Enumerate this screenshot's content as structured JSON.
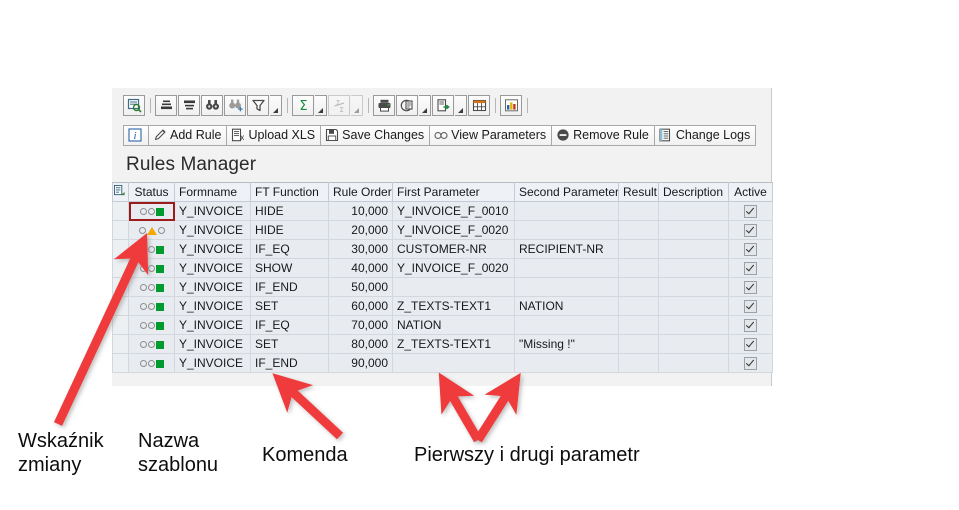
{
  "app": {
    "grid_title": "Rules Manager"
  },
  "icon_toolbar": {
    "buttons": [
      {
        "name": "details-icon",
        "glyph": "detail"
      },
      {
        "name": "sort-ascending-icon",
        "glyph": "sort-asc"
      },
      {
        "name": "sort-descending-icon",
        "glyph": "sort-desc"
      },
      {
        "name": "find-icon",
        "glyph": "binoculars"
      },
      {
        "name": "find-next-icon",
        "glyph": "binoculars-plus"
      },
      {
        "name": "filter-icon",
        "glyph": "funnel",
        "dropdown": true
      },
      {
        "name": "total-icon",
        "glyph": "sigma",
        "dropdown": true
      },
      {
        "name": "subtotal-icon",
        "glyph": "sigma-fraction",
        "dropdown": true,
        "disabled": true
      },
      {
        "name": "print-icon",
        "glyph": "printer"
      },
      {
        "name": "export-view-icon",
        "glyph": "view-export",
        "dropdown": true
      },
      {
        "name": "export-icon",
        "glyph": "export-arrow",
        "dropdown": true
      },
      {
        "name": "layout-icon",
        "glyph": "table-grid"
      },
      {
        "name": "graphic-icon",
        "glyph": "bar-chart"
      }
    ]
  },
  "fn_toolbar": {
    "buttons": [
      {
        "label": "",
        "icon": "info-icon",
        "name": "info-button"
      },
      {
        "label": "Add Rule",
        "icon": "pencil-icon",
        "name": "add-rule-button"
      },
      {
        "label": "Upload XLS",
        "icon": "xls-upload-icon",
        "name": "upload-xls-button"
      },
      {
        "label": "Save Changes",
        "icon": "floppy-icon",
        "name": "save-changes-button"
      },
      {
        "label": "View Parameters",
        "icon": "glasses-icon",
        "name": "view-parameters-button"
      },
      {
        "label": "Remove Rule",
        "icon": "minus-circle-icon",
        "name": "remove-rule-button"
      },
      {
        "label": "Change Logs",
        "icon": "log-book-icon",
        "name": "change-logs-button"
      }
    ]
  },
  "grid": {
    "columns": [
      {
        "key": "status",
        "label": "Status",
        "width": 46,
        "align": "center"
      },
      {
        "key": "form",
        "label": "Formname",
        "width": 76,
        "align": "left"
      },
      {
        "key": "ft",
        "label": "FT Function",
        "width": 78,
        "align": "left"
      },
      {
        "key": "order",
        "label": "Rule Order",
        "width": 64,
        "align": "right"
      },
      {
        "key": "param1",
        "label": "First Parameter",
        "width": 122,
        "align": "left"
      },
      {
        "key": "param2",
        "label": "Second Parameter",
        "width": 104,
        "align": "left"
      },
      {
        "key": "result",
        "label": "Result",
        "width": 40,
        "align": "left"
      },
      {
        "key": "descr",
        "label": "Description",
        "width": 70,
        "align": "left"
      },
      {
        "key": "active",
        "label": "Active",
        "width": 44,
        "align": "center"
      }
    ],
    "rows": [
      {
        "status": "ring-ring-greensquare",
        "selected": true,
        "form": "Y_INVOICE",
        "ft": "HIDE",
        "order": "10,000",
        "param1": "Y_INVOICE_F_0010",
        "param2": "",
        "result": "",
        "descr": "",
        "active": true
      },
      {
        "status": "ring-orangetriangle-ring",
        "selected": false,
        "form": "Y_INVOICE",
        "ft": "HIDE",
        "order": "20,000",
        "param1": "Y_INVOICE_F_0020",
        "param2": "",
        "result": "",
        "descr": "",
        "active": true
      },
      {
        "status": "ring-ring-greensquare",
        "selected": false,
        "form": "Y_INVOICE",
        "ft": "IF_EQ",
        "order": "30,000",
        "param1": "CUSTOMER-NR",
        "param2": "RECIPIENT-NR",
        "result": "",
        "descr": "",
        "active": true
      },
      {
        "status": "ring-ring-greensquare",
        "selected": false,
        "form": "Y_INVOICE",
        "ft": "SHOW",
        "order": "40,000",
        "param1": "Y_INVOICE_F_0020",
        "param2": "",
        "result": "",
        "descr": "",
        "active": true
      },
      {
        "status": "ring-ring-greensquare",
        "selected": false,
        "form": "Y_INVOICE",
        "ft": "IF_END",
        "order": "50,000",
        "param1": "",
        "param2": "",
        "result": "",
        "descr": "",
        "active": true
      },
      {
        "status": "ring-ring-greensquare",
        "selected": false,
        "form": "Y_INVOICE",
        "ft": "SET",
        "order": "60,000",
        "param1": "Z_TEXTS-TEXT1",
        "param2": "NATION",
        "result": "",
        "descr": "",
        "active": true
      },
      {
        "status": "ring-ring-greensquare",
        "selected": false,
        "form": "Y_INVOICE",
        "ft": "IF_EQ",
        "order": "70,000",
        "param1": "NATION",
        "param2": "",
        "result": "",
        "descr": "",
        "active": true
      },
      {
        "status": "ring-ring-greensquare",
        "selected": false,
        "form": "Y_INVOICE",
        "ft": "SET",
        "order": "80,000",
        "param1": "Z_TEXTS-TEXT1",
        "param2": "\"Missing !\"",
        "result": "",
        "descr": "",
        "active": true
      },
      {
        "status": "ring-ring-greensquare",
        "selected": false,
        "form": "Y_INVOICE",
        "ft": "IF_END",
        "order": "90,000",
        "param1": "",
        "param2": "",
        "result": "",
        "descr": "",
        "active": true
      }
    ]
  },
  "annotations": {
    "arrow_color": "#ef3b3b",
    "labels": [
      {
        "id": "anno-1",
        "name": "annotation-change-indicator",
        "text": "Wskaźnik\nzmiany"
      },
      {
        "id": "anno-2",
        "name": "annotation-template-name",
        "text": "Nazwa\nszablonu"
      },
      {
        "id": "anno-3",
        "name": "annotation-command",
        "text": "Komenda"
      },
      {
        "id": "anno-4",
        "name": "annotation-parameters",
        "text": "Pierwszy i drugi parametr"
      }
    ]
  },
  "colors": {
    "key_column": "#a9e7f5",
    "data_cell": "#e8ecf0",
    "header": "#eef1f5",
    "status_green": "#009a2e",
    "status_orange": "#f5a800",
    "annotation_red": "#ef3b3b",
    "selection_red": "#9c1b1b"
  }
}
